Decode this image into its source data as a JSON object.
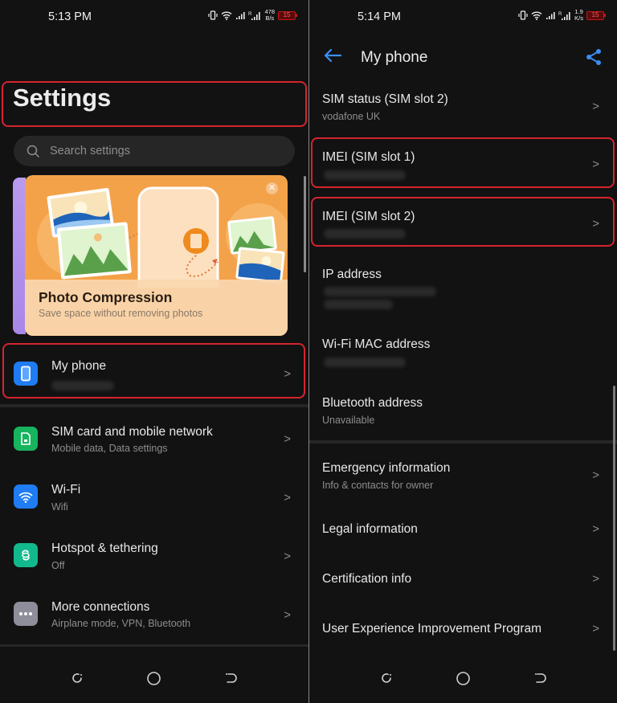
{
  "left_screen": {
    "status_bar": {
      "time": "5:13 PM",
      "net_speed_value": "478",
      "net_speed_unit": "B/s",
      "network_type": "R",
      "battery_level": "15",
      "icons": [
        "vibrate-icon",
        "wifi-icon",
        "signal-icon",
        "signal-roaming-icon",
        "battery-icon"
      ]
    },
    "title": "Settings",
    "search": {
      "placeholder": "Search settings"
    },
    "banner": {
      "title": "Photo Compression",
      "subtitle": "Save space without removing photos",
      "close_icon": "close-icon"
    },
    "items": [
      {
        "label": "My phone",
        "sublabel": "",
        "icon": "phone-icon",
        "color": "#1f7cf2",
        "highlighted": true
      },
      {
        "label": "SIM card and mobile network",
        "sublabel": "Mobile data, Data settings",
        "icon": "sim-card-icon",
        "color": "#17b35f"
      },
      {
        "label": "Wi-Fi",
        "sublabel": "Wifi",
        "icon": "wifi-icon",
        "color": "#1f7cf2"
      },
      {
        "label": "Hotspot & tethering",
        "sublabel": "Off",
        "icon": "hotspot-icon",
        "color": "#12b98c"
      },
      {
        "label": "More connections",
        "sublabel": "Airplane mode, VPN, Bluetooth",
        "icon": "more-icon",
        "color": "#8e8e9a"
      }
    ],
    "nav": [
      "recents-button",
      "home-button",
      "back-button"
    ]
  },
  "right_screen": {
    "status_bar": {
      "time": "5:14 PM",
      "net_speed_value": "1.9",
      "net_speed_unit": "K/s",
      "network_type": "R",
      "battery_level": "15"
    },
    "title": "My phone",
    "items": [
      {
        "label": "SIM status (SIM slot 2)",
        "sublabel": "vodafone UK",
        "chevron": true
      },
      {
        "label": "IMEI (SIM slot 1)",
        "sublabel": "",
        "chevron": true,
        "highlighted": true,
        "redacted": true
      },
      {
        "label": "IMEI (SIM slot 2)",
        "sublabel": "",
        "chevron": true,
        "highlighted": true,
        "redacted": true
      },
      {
        "label": "IP address",
        "sublabel": "",
        "chevron": false,
        "redacted": true
      },
      {
        "label": "Wi-Fi MAC address",
        "sublabel": "",
        "chevron": false,
        "redacted": true
      },
      {
        "label": "Bluetooth address",
        "sublabel": "Unavailable",
        "chevron": false
      },
      {
        "label": "Emergency information",
        "sublabel": "Info & contacts for owner",
        "chevron": true
      },
      {
        "label": "Legal information",
        "sublabel": "",
        "chevron": true
      },
      {
        "label": "Certification info",
        "sublabel": "",
        "chevron": true
      },
      {
        "label": "User Experience Improvement Program",
        "sublabel": "",
        "chevron": true
      }
    ]
  },
  "colors": {
    "background": "#121212",
    "highlight": "#d5242e",
    "accent": "#3b8ef0"
  }
}
